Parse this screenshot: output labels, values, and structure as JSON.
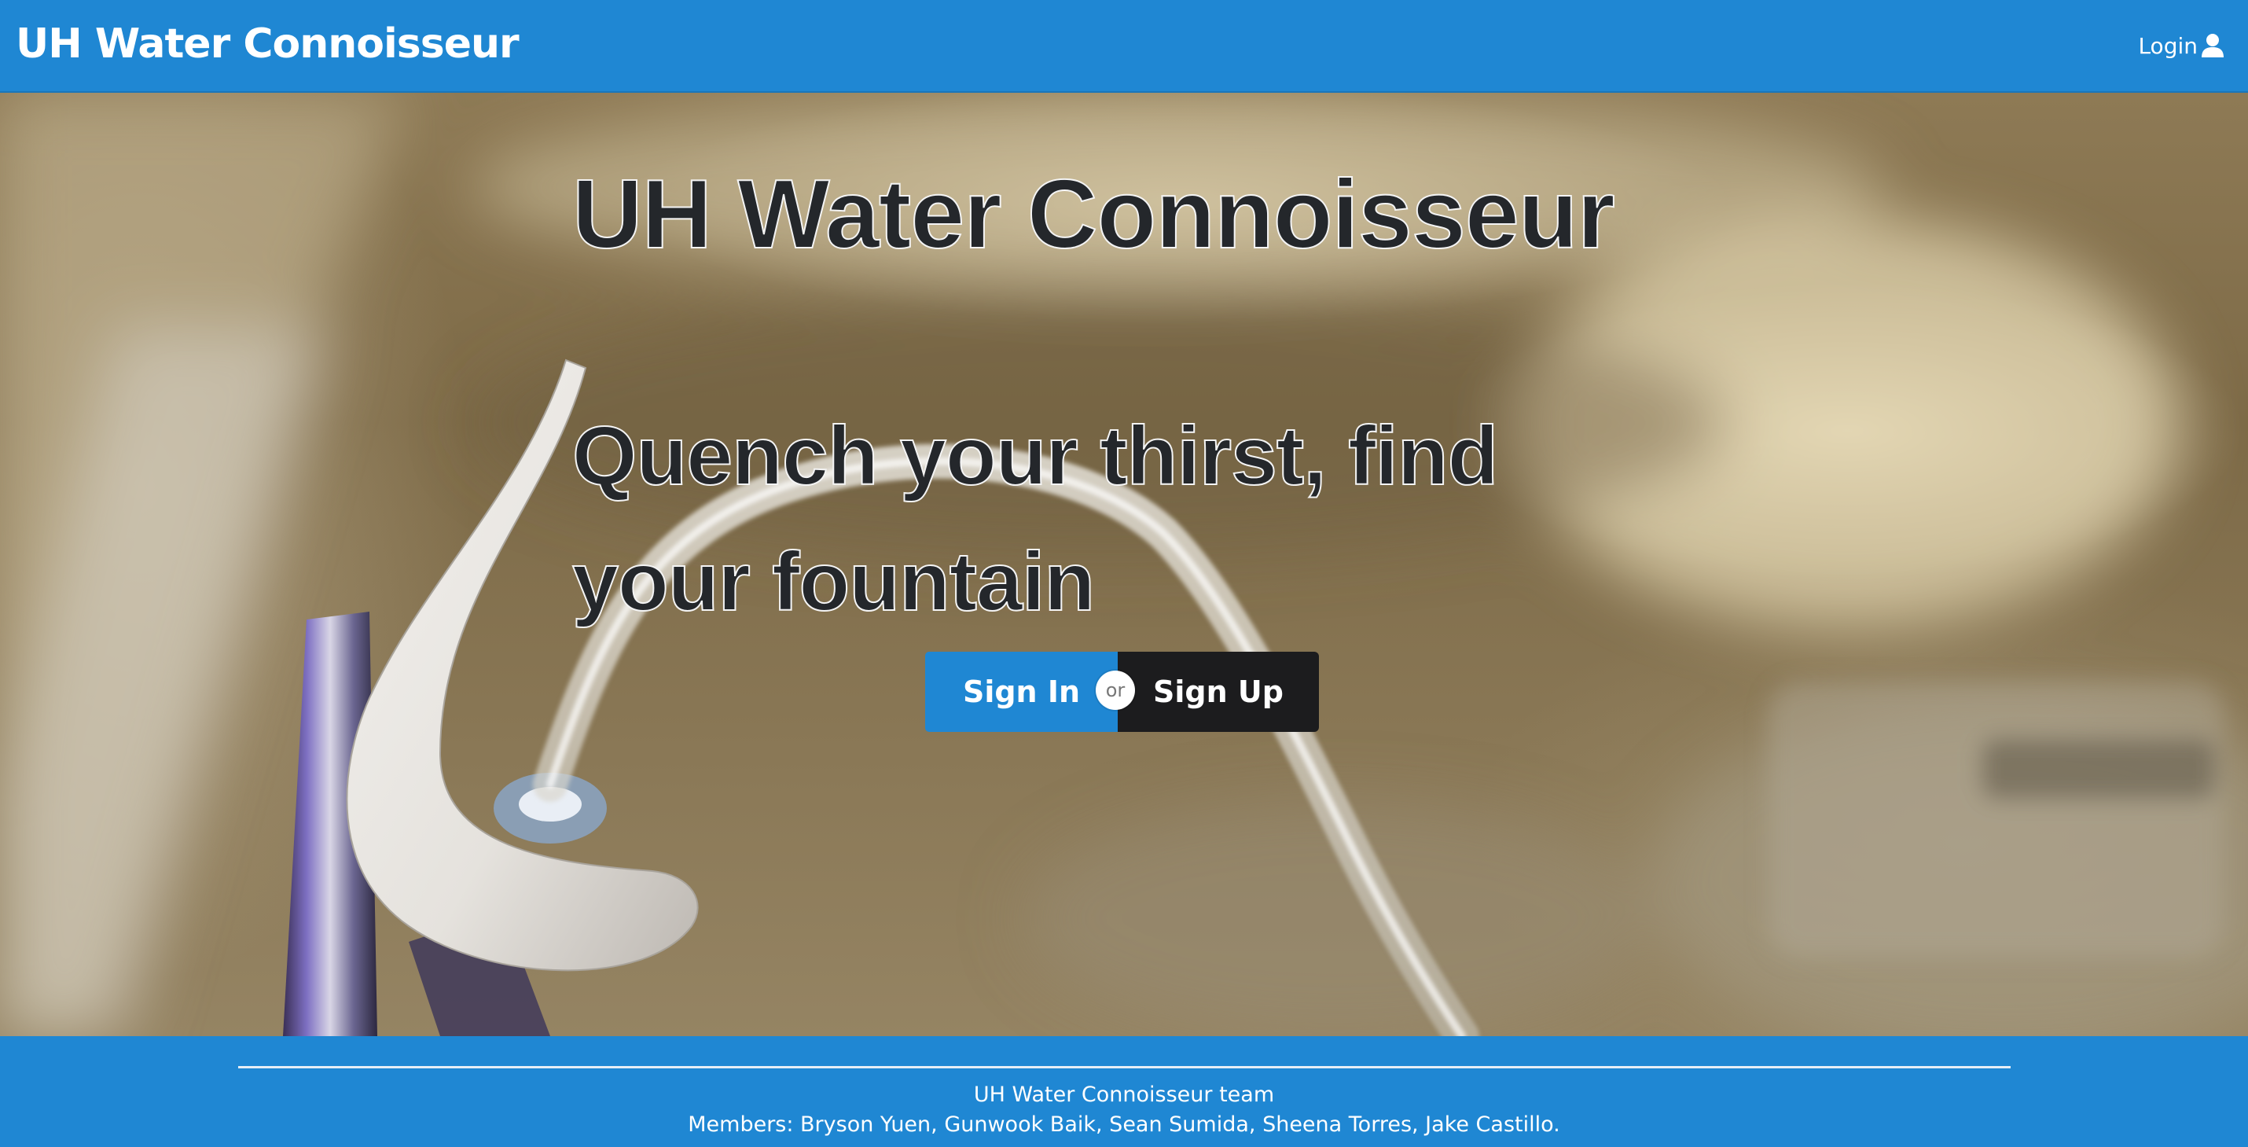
{
  "navbar": {
    "brand": "UH Water Connoisseur",
    "login_label": "Login",
    "login_icon": "user-icon"
  },
  "hero": {
    "title": "UH Water Connoisseur",
    "tagline": "Quench your thirst, find your fountain",
    "background_image": "drinking-fountain-photo",
    "buttons": {
      "signin_label": "Sign In",
      "or_label": "or",
      "signup_label": "Sign Up"
    }
  },
  "footer": {
    "team": "UH Water Connoisseur team",
    "members": "Members: Bryson Yuen, Gunwook Baik, Sean Sumida, Sheena Torres, Jake Castillo."
  },
  "colors": {
    "primary": "#1f87d3",
    "dark_button": "#1c1c1e",
    "hero_text": "#24272b",
    "white": "#ffffff"
  }
}
